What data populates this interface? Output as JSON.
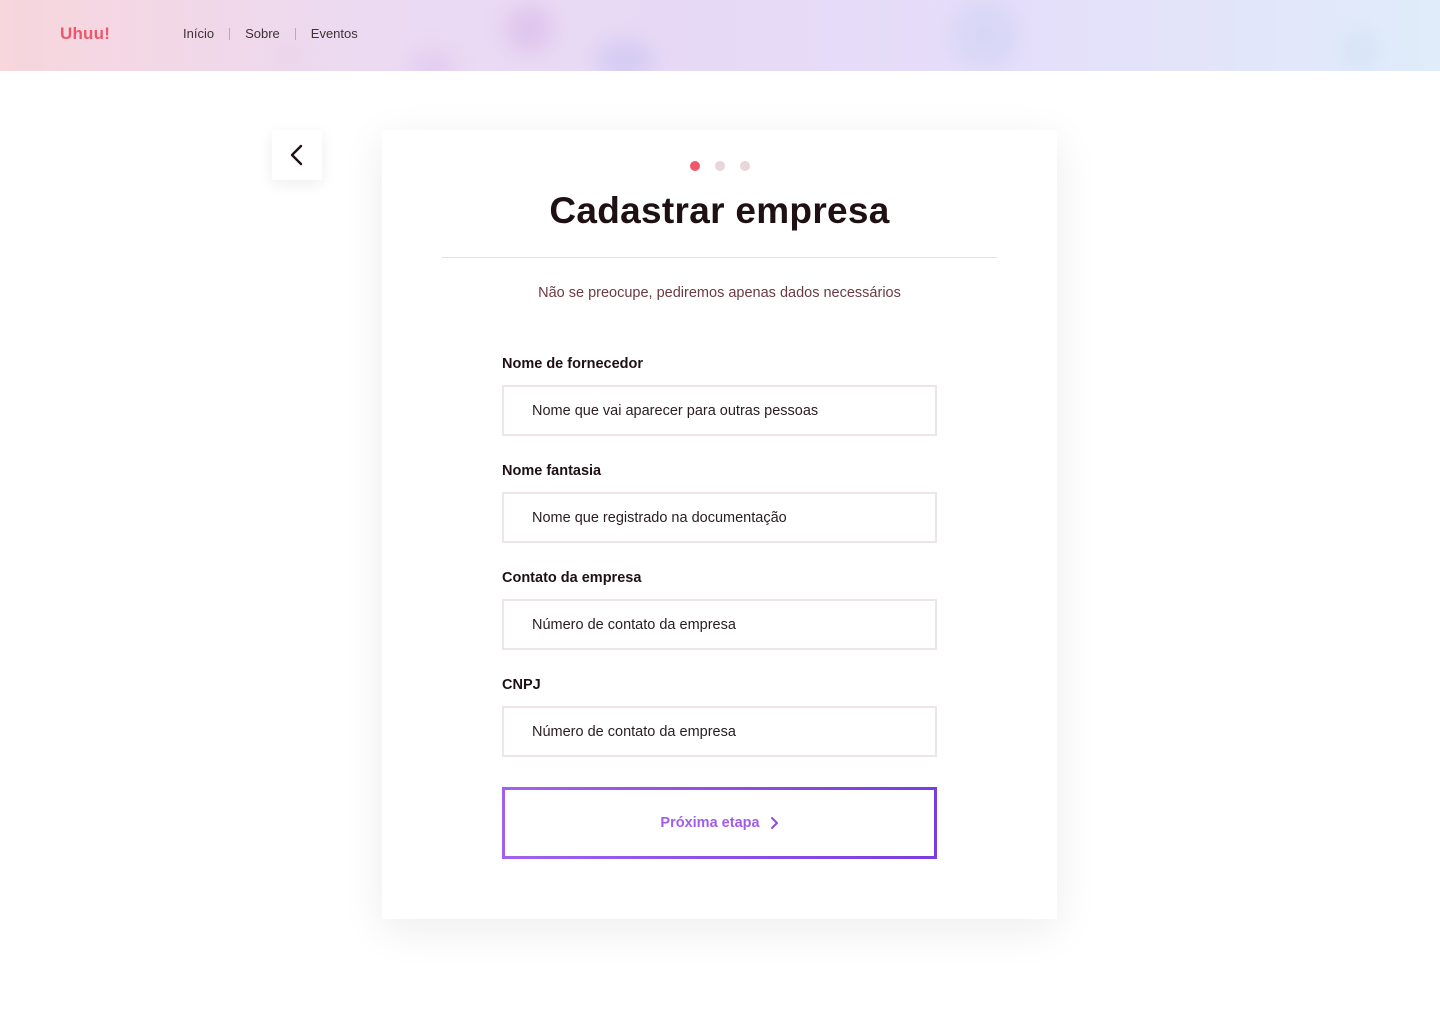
{
  "header": {
    "logo": "Uhuu!",
    "nav": [
      "Início",
      "Sobre",
      "Eventos"
    ]
  },
  "card": {
    "steps": {
      "total": 3,
      "current": 1
    },
    "title": "Cadastrar empresa",
    "subtitle": "Não se preocupe, pediremos apenas dados necessários",
    "fields": [
      {
        "label": "Nome de fornecedor",
        "placeholder": "Nome que vai aparecer para outras pessoas"
      },
      {
        "label": "Nome fantasia",
        "placeholder": "Nome que registrado na documentação"
      },
      {
        "label": "Contato da empresa",
        "placeholder": "Número de contato da empresa"
      },
      {
        "label": "CNPJ",
        "placeholder": "Número de contato da empresa"
      }
    ],
    "next_button": "Próxima etapa"
  },
  "icons": {
    "back": "chevron-left-icon",
    "next": "chevron-right-icon"
  },
  "colors": {
    "brand": "#f0566b",
    "accent": "#8b4be8",
    "step_active": "#f05a68",
    "step_inactive": "#e8d6d9"
  }
}
